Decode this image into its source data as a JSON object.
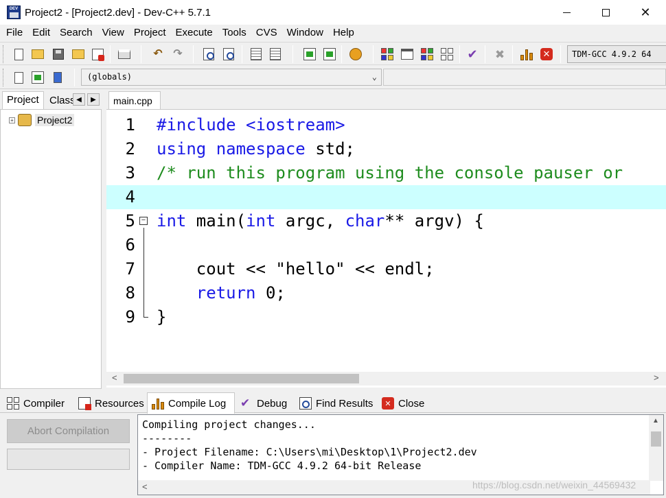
{
  "window": {
    "title": "Project2 - [Project2.dev] - Dev-C++ 5.7.1",
    "icon": "dev-cpp-icon"
  },
  "menu": [
    "File",
    "Edit",
    "Search",
    "View",
    "Project",
    "Execute",
    "Tools",
    "CVS",
    "Window",
    "Help"
  ],
  "toolbar": {
    "compiler_selector": "TDM-GCC 4.9.2 64",
    "scope_selector": "(globals)"
  },
  "left_panel": {
    "tabs": [
      "Project",
      "Classes"
    ],
    "tree": [
      {
        "label": "Project2"
      }
    ]
  },
  "editor": {
    "tab_label": "main.cpp",
    "highlighted_line": 4,
    "lines": [
      {
        "n": "1",
        "text": "#include <iostream>"
      },
      {
        "n": "2",
        "text": "using namespace std;"
      },
      {
        "n": "3",
        "text": "/* run this program using the console pauser or"
      },
      {
        "n": "4",
        "text": ""
      },
      {
        "n": "5",
        "text": "int main(int argc, char** argv) {"
      },
      {
        "n": "6",
        "text": ""
      },
      {
        "n": "7",
        "text": "    cout << \"hello\" << endl;"
      },
      {
        "n": "8",
        "text": "    return 0;"
      },
      {
        "n": "9",
        "text": "}"
      }
    ]
  },
  "bottom_panel": {
    "tabs": [
      "Compiler",
      "Resources",
      "Compile Log",
      "Debug",
      "Find Results",
      "Close"
    ],
    "active_tab": "Compile Log",
    "abort_button": "Abort Compilation",
    "log": [
      "Compiling project changes...",
      "--------",
      "- Project Filename: C:\\Users\\mi\\Desktop\\1\\Project2.dev",
      "- Compiler Name: TDM-GCC 4.9.2 64-bit Release"
    ]
  },
  "watermark": "https://blog.csdn.net/weixin_44569432"
}
